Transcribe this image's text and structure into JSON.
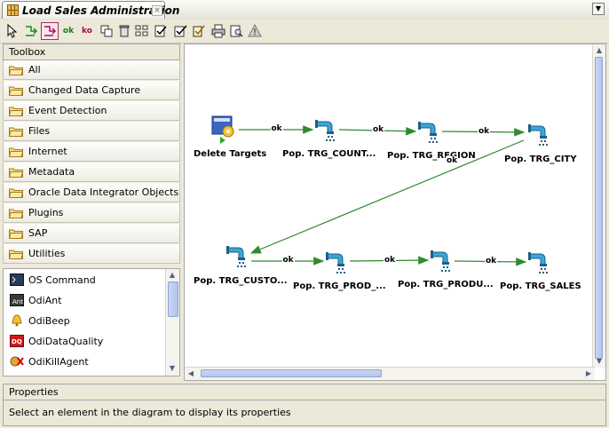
{
  "window": {
    "tab_title": "Load Sales Administration"
  },
  "toolbar": {
    "items": [
      {
        "name": "select-tool",
        "icon": "pointer-icon"
      },
      {
        "name": "next-step-on-success",
        "icon": "green-arrow-icon"
      },
      {
        "name": "next-step-on-failure",
        "icon": "red-arrow-icon"
      },
      {
        "name": "ok-link",
        "label": "ok"
      },
      {
        "name": "ko-link",
        "label": "ko"
      },
      {
        "name": "duplicate",
        "icon": "duplicate-icon"
      },
      {
        "name": "delete",
        "icon": "trash-icon"
      },
      {
        "name": "arrange",
        "icon": "arrange-icon"
      },
      {
        "name": "validate",
        "icon": "checklist-icon"
      },
      {
        "name": "validate-all",
        "icon": "checklist-all-icon"
      },
      {
        "name": "execute",
        "icon": "execute-icon"
      },
      {
        "name": "print",
        "icon": "print-icon"
      },
      {
        "name": "print-preview",
        "icon": "print-preview-icon"
      },
      {
        "name": "warning",
        "icon": "warning-icon"
      }
    ]
  },
  "toolbox": {
    "title": "Toolbox",
    "categories": [
      "All",
      "Changed Data Capture",
      "Event Detection",
      "Files",
      "Internet",
      "Metadata",
      "Oracle Data Integrator Objects",
      "Plugins",
      "SAP",
      "Utilities"
    ],
    "items": [
      {
        "label": "OS Command",
        "icon": "os-command-icon"
      },
      {
        "label": "OdiAnt",
        "icon": "ant-icon"
      },
      {
        "label": "OdiBeep",
        "icon": "bell-icon"
      },
      {
        "label": "OdiDataQuality",
        "icon": "data-quality-icon"
      },
      {
        "label": "OdiKillAgent",
        "icon": "kill-agent-icon"
      }
    ]
  },
  "diagram": {
    "nodes": [
      {
        "id": "delete-targets",
        "label": "Delete Targets",
        "icon": "procedure-icon",
        "first_step": true
      },
      {
        "id": "trg-country",
        "label": "Pop. TRG_COUNT...",
        "icon": "interface-icon"
      },
      {
        "id": "trg-region",
        "label": "Pop. TRG_REGION",
        "icon": "interface-icon"
      },
      {
        "id": "trg-city",
        "label": "Pop. TRG_CITY",
        "icon": "interface-icon"
      },
      {
        "id": "trg-customer",
        "label": "Pop. TRG_CUSTO...",
        "icon": "interface-icon"
      },
      {
        "id": "trg-prod-family",
        "label": "Pop. TRG_PROD_...",
        "icon": "interface-icon"
      },
      {
        "id": "trg-product",
        "label": "Pop. TRG_PRODU...",
        "icon": "interface-icon"
      },
      {
        "id": "trg-sales",
        "label": "Pop. TRG_SALES",
        "icon": "interface-icon"
      }
    ],
    "links": [
      {
        "from": "delete-targets",
        "to": "trg-country",
        "label": "ok"
      },
      {
        "from": "trg-country",
        "to": "trg-region",
        "label": "ok"
      },
      {
        "from": "trg-region",
        "to": "trg-city",
        "label": "ok"
      },
      {
        "from": "trg-city",
        "to": "trg-customer",
        "label": "ok"
      },
      {
        "from": "trg-customer",
        "to": "trg-prod-family",
        "label": "ok"
      },
      {
        "from": "trg-prod-family",
        "to": "trg-product",
        "label": "ok"
      },
      {
        "from": "trg-product",
        "to": "trg-sales",
        "label": "ok"
      }
    ],
    "link_color": "#2e8b2e"
  },
  "properties": {
    "title": "Properties",
    "hint": "Select an element in the diagram to display its properties"
  }
}
